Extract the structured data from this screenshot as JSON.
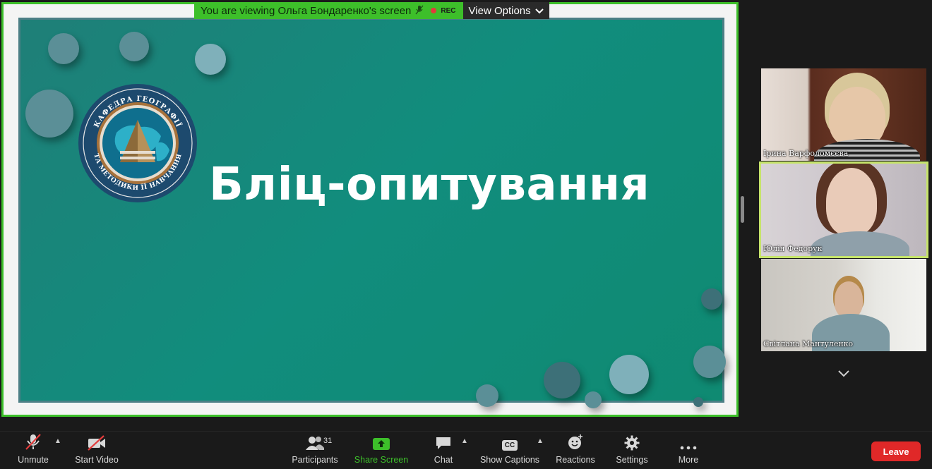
{
  "banner": {
    "viewing_text": "You are viewing Ольга Бондаренко's screen",
    "rec_label": "REC",
    "view_options_label": "View Options"
  },
  "slide": {
    "title": "Бліц-опитування",
    "emblem_top_text": "КАФЕДРА ГЕОГРАФІЇ",
    "emblem_bottom_text": "ТА МЕТОДИКИ ЇЇ НАВЧАННЯ"
  },
  "participants_tiles": [
    {
      "name": "Ірина Варфоломєєва",
      "active": false
    },
    {
      "name": "Юлія Федорук",
      "active": true
    },
    {
      "name": "Світлана Мантуленко",
      "active": false
    }
  ],
  "toolbar": {
    "unmute_label": "Unmute",
    "start_video_label": "Start Video",
    "participants_label": "Participants",
    "participants_count": "31",
    "share_screen_label": "Share Screen",
    "chat_label": "Chat",
    "captions_label": "Show Captions",
    "captions_icon_text": "CC",
    "reactions_label": "Reactions",
    "settings_label": "Settings",
    "more_label": "More",
    "leave_label": "Leave"
  },
  "colors": {
    "share_border": "#3dbf2a",
    "slide_bg": "#118d7d",
    "active_speaker": "#c6e46b",
    "leave": "#e02828"
  }
}
